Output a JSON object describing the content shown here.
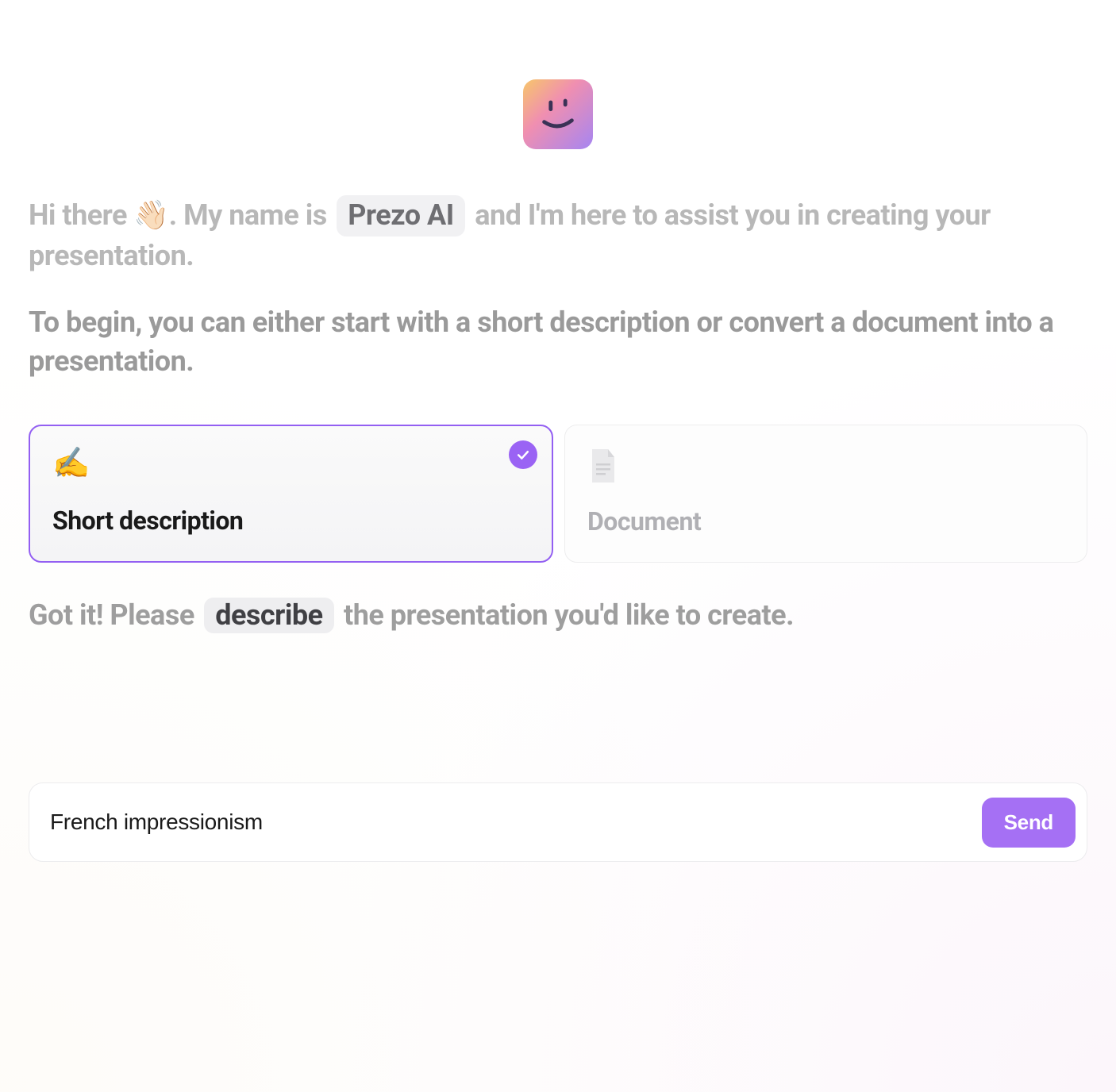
{
  "app": {
    "name": "Prezo AI"
  },
  "intro": {
    "greeting_pre": "Hi there",
    "wave_emoji": "👋🏻",
    "greeting_mid": ". My name is",
    "name_chip": "Prezo AI",
    "greeting_post": "and I'm here to assist you in creating your presentation.",
    "instruction": "To begin, you can either start with a short description or convert a document into a presentation."
  },
  "options": [
    {
      "id": "short-description",
      "emoji": "✍️",
      "label": "Short description",
      "selected": true
    },
    {
      "id": "document",
      "icon": "document-icon",
      "label": "Document",
      "selected": false
    }
  ],
  "followup": {
    "pre": "Got it! Please",
    "chip": "describe",
    "post": "the presentation you'd like to create."
  },
  "composer": {
    "value": "French impressionism",
    "placeholder": "",
    "send_label": "Send"
  },
  "colors": {
    "accent": "#935ff2",
    "accent_light": "#a570f4",
    "muted_text": "#9e9e9e"
  }
}
